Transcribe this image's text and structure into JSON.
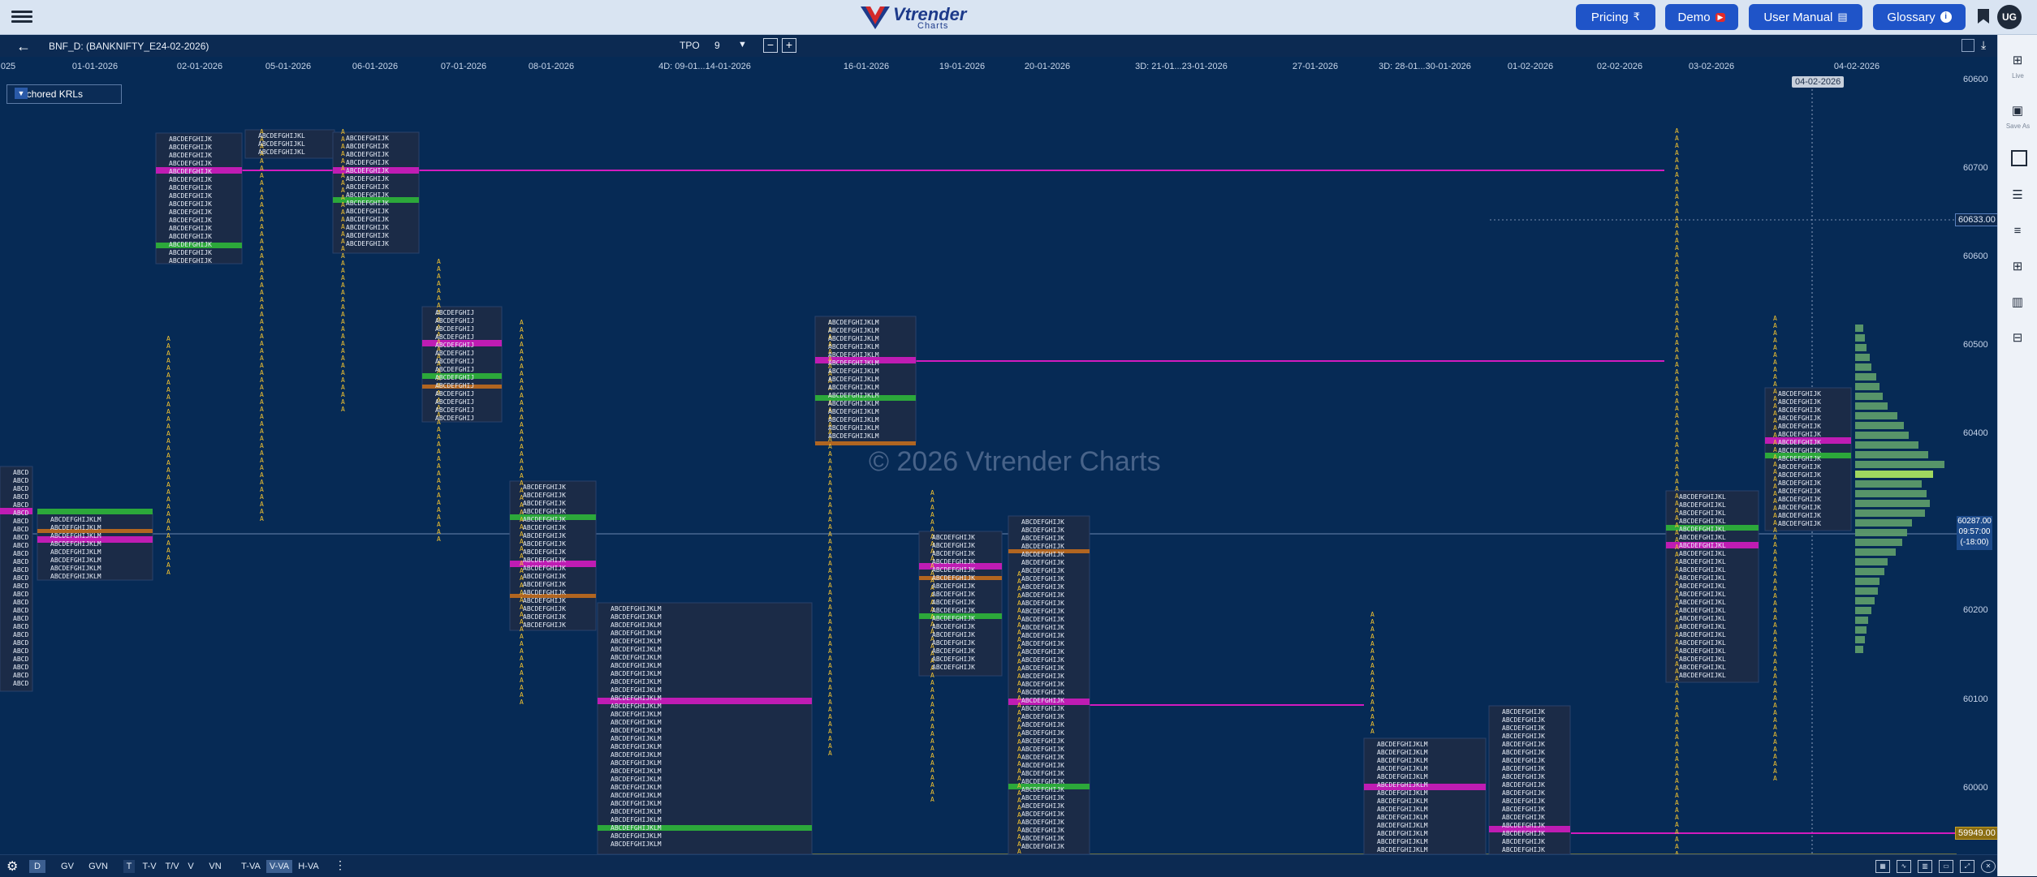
{
  "header": {
    "logo_brand": "Vtrender",
    "logo_sub": "Charts",
    "nav": [
      {
        "label": "Pricing",
        "icon": "rupee-icon",
        "glyph": "₹"
      },
      {
        "label": "Demo",
        "icon": "youtube-icon",
        "glyph": "▶"
      },
      {
        "label": "User Manual",
        "icon": "manual-icon",
        "glyph": "▤"
      },
      {
        "label": "Glossary",
        "icon": "info-icon",
        "glyph": "i"
      }
    ],
    "avatar": "UG"
  },
  "toolbar": {
    "symbol": "BNF_D: (BANKNIFTY_E24-02-2026)",
    "tpo_label": "TPO",
    "tpo_value": "9",
    "minus": "−",
    "plus": "+"
  },
  "chart": {
    "dates": [
      "025",
      "01-01-2026",
      "02-01-2026",
      "05-01-2026",
      "06-01-2026",
      "07-01-2026",
      "08-01-2026",
      "4D: 09-01...14-01-2026",
      "16-01-2026",
      "19-01-2026",
      "20-01-2026",
      "3D: 21-01...23-01-2026",
      "27-01-2026",
      "3D: 28-01...30-01-2026",
      "01-02-2026",
      "02-02-2026",
      "03-02-2026",
      "04-02-2026"
    ],
    "anchored_dropdown": "Anchored KRLs",
    "watermark": "© 2026 Vtrender Charts",
    "price_labels": [
      "60600",
      "60500",
      "60400",
      "60200",
      "60100",
      "60000"
    ],
    "price_label_60700": "60700",
    "tag_60633": "60633.00",
    "tag_current": "60287.00",
    "tag_time": "09:57:00",
    "tag_delta": "(-18:00)",
    "tag_59949": "59949.00",
    "hover_date": "04-02-2026",
    "accent_colors": {
      "poc": "#d21bbf",
      "ib": "#2ca83a",
      "va_ext": "#c26b1c",
      "tpo": "#f2c230",
      "profile": "#1b2b47"
    }
  },
  "right_panel": {
    "live": "Live",
    "save_as": "Save As"
  },
  "bottom": {
    "tabs": [
      "D",
      "GV",
      "GVN",
      "T",
      "T-V",
      "T/V",
      "V",
      "VN",
      "T-VA",
      "V-VA",
      "H-VA"
    ],
    "selected": [
      "D",
      "V-VA"
    ]
  }
}
